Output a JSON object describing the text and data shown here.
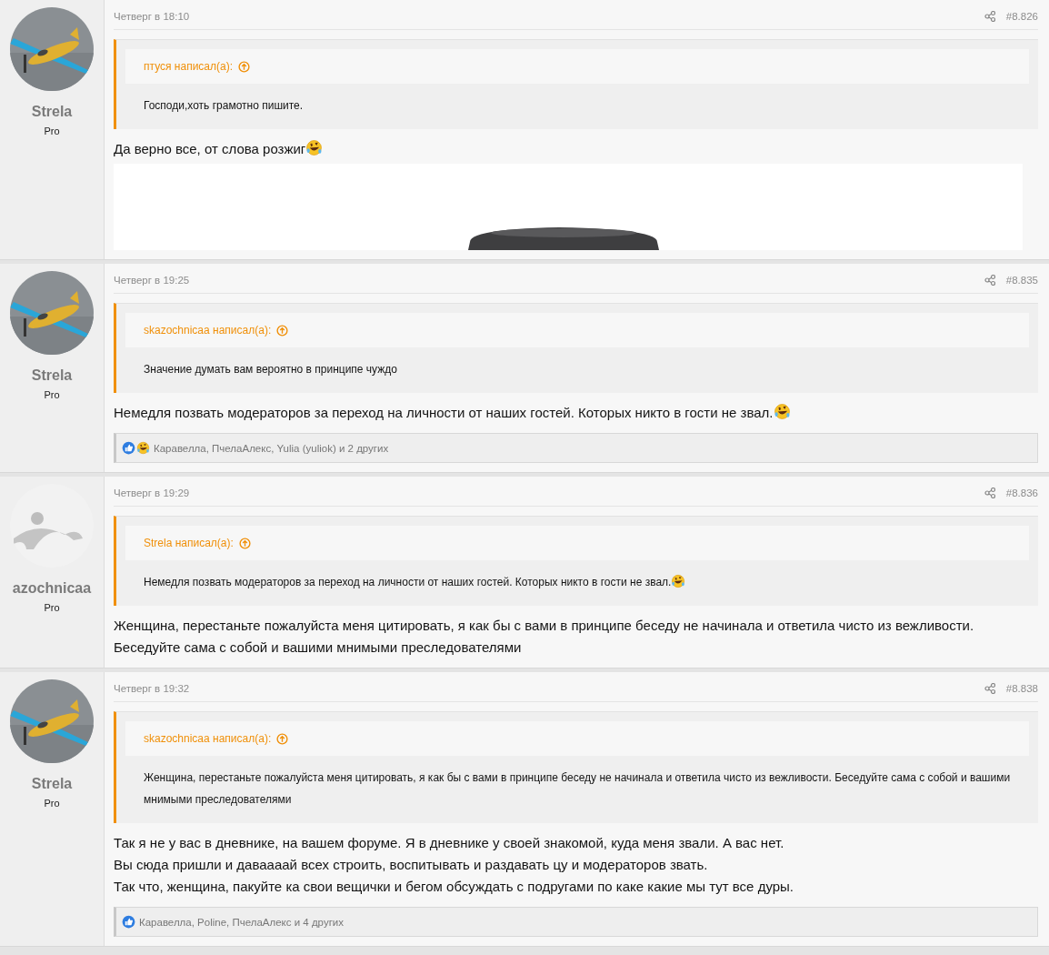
{
  "posts": [
    {
      "author": "Strela",
      "role": "Pro",
      "avatar": {
        "kind": "picture"
      },
      "date": "Четверг в 18:10",
      "number": "#8.826",
      "quote": {
        "author": "птуся написал(а):",
        "text": "Господи,хоть грамотно пишите.",
        "emoji": false
      },
      "body": [
        {
          "text": "Да верно все, от слова розжиг",
          "emoji": true
        }
      ],
      "image": {
        "kind": "picture"
      }
    },
    {
      "author": "Strela",
      "role": "Pro",
      "avatar": {
        "kind": "picture"
      },
      "date": "Четверг в 19:25",
      "number": "#8.835",
      "quote": {
        "author": "skazochnicaa написал(а):",
        "text": "Значение думать вам вероятно в принципе чуждо",
        "emoji": false
      },
      "body": [
        {
          "text": "Немедля позвать модераторов за переход на личности от наших гостей. Которых никто в гости не звал.",
          "emoji": true
        }
      ],
      "reactions": {
        "icons": [
          {
            "kind": "like"
          },
          {
            "kind": "laugh"
          }
        ],
        "text": "Каравелла, ПчелаАлекс, Yulia (yuliok) и 2 других"
      }
    },
    {
      "author": "azochnicaa",
      "role": "Pro",
      "avatar": {
        "kind": "default"
      },
      "date": "Четверг в 19:29",
      "number": "#8.836",
      "quote": {
        "author": "Strela написал(а):",
        "text": "Немедля позвать модераторов за переход на личности от наших гостей. Которых никто в гости не звал.",
        "emoji": true
      },
      "body": [
        {
          "text": "Женщина, перестаньте пожалуйста меня цитировать, я как бы с вами в принципе беседу не начинала и ответила чисто из вежливости.",
          "emoji": false
        },
        {
          "text": "Беседуйте сама с собой и вашими мнимыми преследователями",
          "emoji": false
        }
      ]
    },
    {
      "author": "Strela",
      "role": "Pro",
      "avatar": {
        "kind": "picture"
      },
      "date": "Четверг в 19:32",
      "number": "#8.838",
      "quote": {
        "author": "skazochnicaa написал(а):",
        "text": "Женщина, перестаньте пожалуйста меня цитировать, я как бы с вами в принципе беседу не начинала и ответила чисто из вежливости. Беседуйте сама с собой и вашими мнимыми преследователями",
        "emoji": false
      },
      "body": [
        {
          "text": "Так я не у вас в дневнике, на вашем форуме. Я в дневнике у своей знакомой, куда меня звали. А вас нет.",
          "emoji": false
        },
        {
          "text": "Вы сюда пришли и даваааай всех строить, воспитывать и раздавать цу и модераторов звать.",
          "emoji": false
        },
        {
          "text": "Так что, женщина, пакуйте ка свои вещички и бегом обсуждать с подругами по каке какие мы тут все дуры.",
          "emoji": false
        }
      ],
      "reactions": {
        "icons": [
          {
            "kind": "like"
          }
        ],
        "text": "Каравелла, Poline, ПчелаАлекс и 4 других"
      }
    }
  ]
}
